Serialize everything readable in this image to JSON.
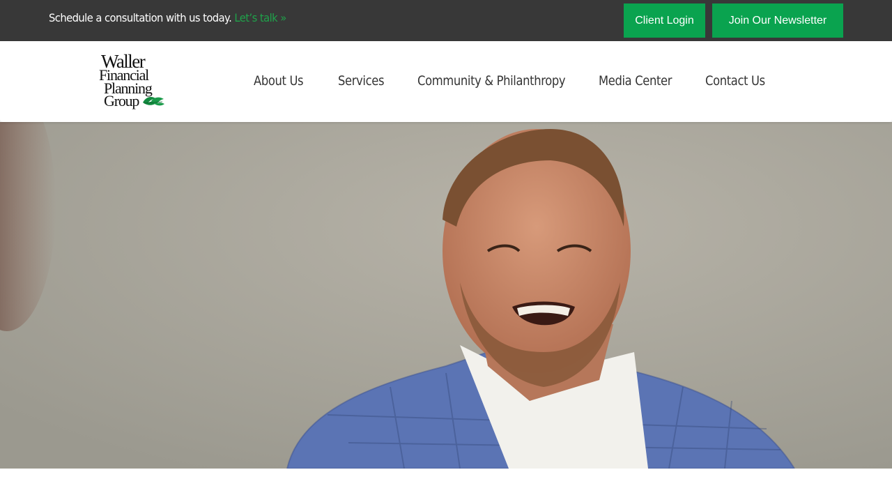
{
  "topbar": {
    "message": "Schedule a consultation with us today.",
    "cta": "Let’s talk »",
    "client_login": "Client Login",
    "newsletter": "Join Our Newsletter"
  },
  "logo": {
    "line1": "Waller",
    "line2": "Financial",
    "line3": "Planning",
    "line4": "Group"
  },
  "nav": {
    "items": [
      {
        "label": "About Us"
      },
      {
        "label": "Services"
      },
      {
        "label": "Community & Philanthropy"
      },
      {
        "label": "Media Center"
      },
      {
        "label": "Contact Us"
      }
    ]
  },
  "colors": {
    "topbar_bg": "#383838",
    "accent_green": "#0aa34f",
    "link_green": "#1fa24a",
    "nav_text": "#333333"
  },
  "hero": {
    "image": "laughing-man-photo"
  }
}
